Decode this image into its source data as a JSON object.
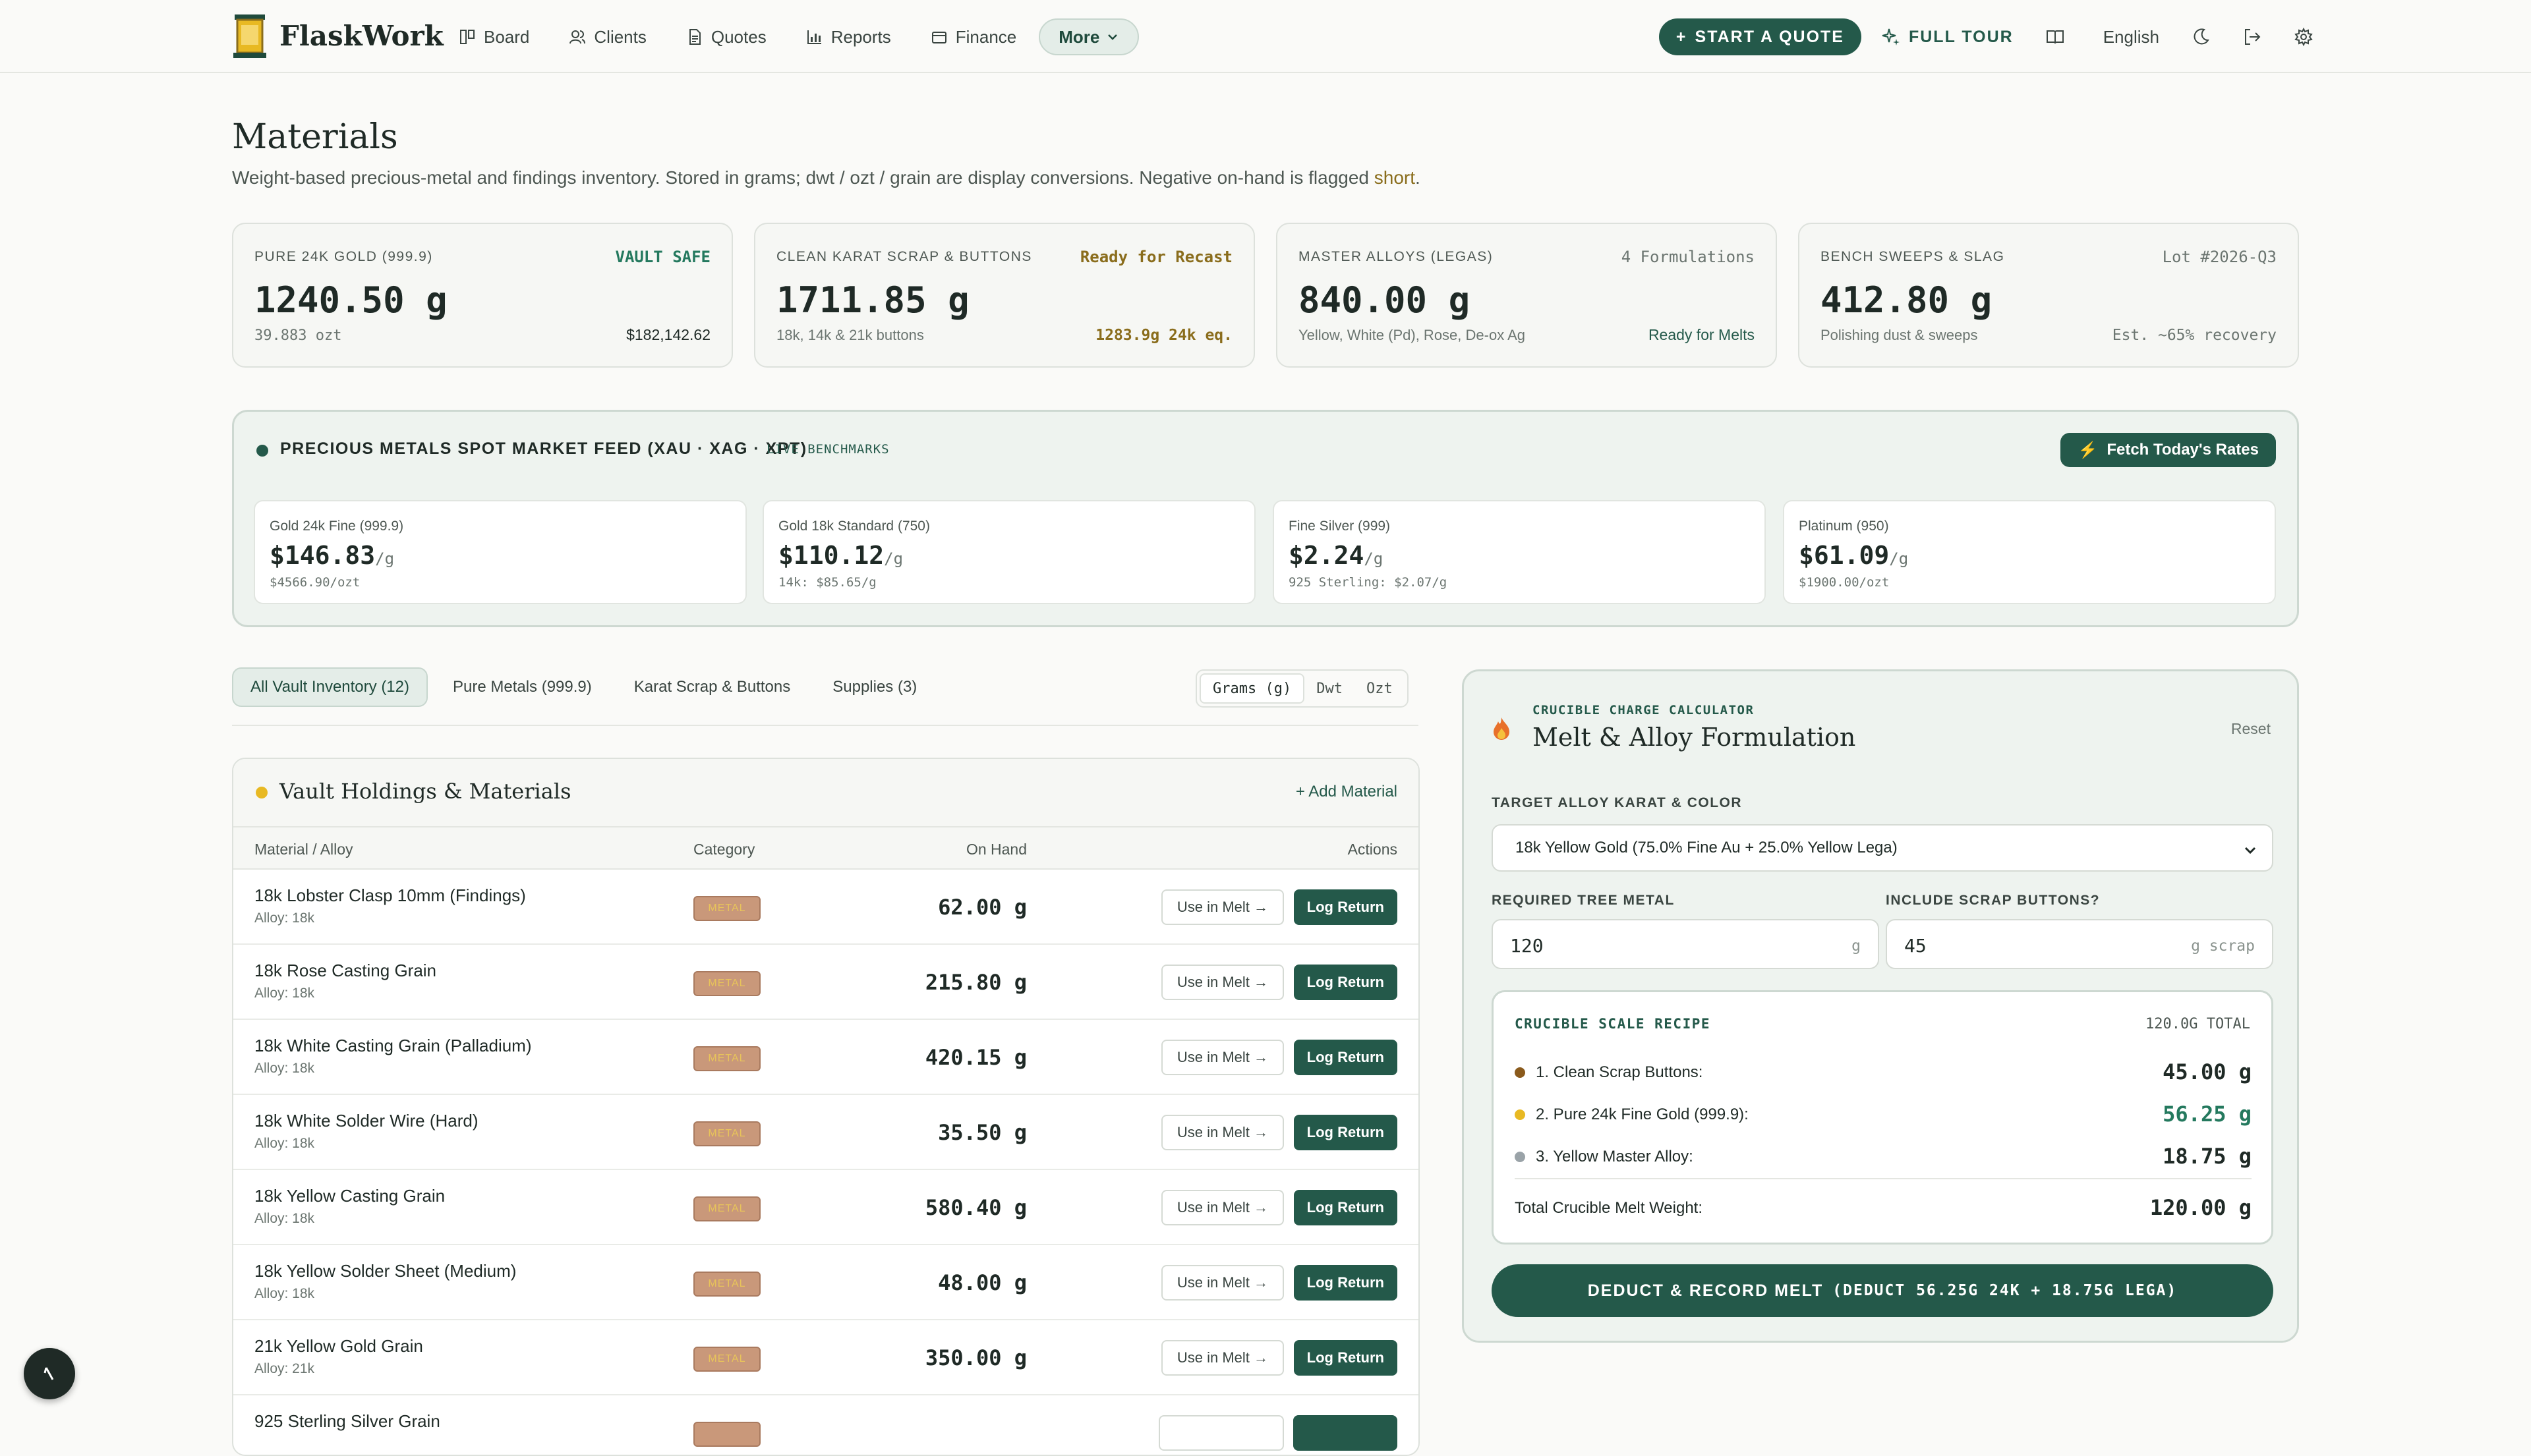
{
  "app": {
    "name": "FlaskWork",
    "nav": [
      {
        "label": "Board",
        "icon": "board-icon"
      },
      {
        "label": "Clients",
        "icon": "users-icon"
      },
      {
        "label": "Quotes",
        "icon": "document-icon"
      },
      {
        "label": "Reports",
        "icon": "chart-icon"
      },
      {
        "label": "Finance",
        "icon": "wallet-icon"
      }
    ],
    "more_label": "More",
    "start_quote": "START A QUOTE",
    "full_tour": "FULL TOUR",
    "language": "English"
  },
  "page": {
    "title": "Materials",
    "subtitle_pre": "Weight-based precious-metal and findings inventory. Stored in grams; dwt / ozt / grain are display conversions. Negative on-hand is flagged ",
    "subtitle_flag": "short",
    "subtitle_post": "."
  },
  "stats": [
    {
      "label": "PURE 24K GOLD (999.9)",
      "tag": "VAULT SAFE",
      "value": "1240.50 g",
      "sub": "39.883 ozt",
      "sub2": "$182,142.62"
    },
    {
      "label": "CLEAN KARAT SCRAP & BUTTONS",
      "tag": "Ready for Recast",
      "value": "1711.85 g",
      "sub": "18k, 14k & 21k buttons",
      "sub2": "1283.9g 24k eq."
    },
    {
      "label": "MASTER ALLOYS (LEGAS)",
      "tag": "4 Formulations",
      "value": "840.00 g",
      "sub": "Yellow, White (Pd), Rose, De-ox Ag",
      "sub2": "Ready for Melts"
    },
    {
      "label": "BENCH SWEEPS & SLAG",
      "tag": "Lot #2026-Q3",
      "value": "412.80 g",
      "sub": "Polishing dust & sweeps",
      "sub2": "Est. ~65% recovery"
    }
  ],
  "spot": {
    "title": "PRECIOUS METALS SPOT MARKET FEED (XAU · XAG · XPT)",
    "live": "LIVE BENCHMARKS",
    "fetch_label": "Fetch Today's Rates",
    "metals": [
      {
        "name": "Gold 24k Fine (999.9)",
        "price": "$146.83",
        "unit": "/g",
        "sub": "$4566.90/ozt"
      },
      {
        "name": "Gold 18k Standard (750)",
        "price": "$110.12",
        "unit": "/g",
        "sub": "14k: $85.65/g"
      },
      {
        "name": "Fine Silver (999)",
        "price": "$2.24",
        "unit": "/g",
        "sub": "925 Sterling: $2.07/g"
      },
      {
        "name": "Platinum (950)",
        "price": "$61.09",
        "unit": "/g",
        "sub": "$1900.00/ozt"
      }
    ]
  },
  "tabs": [
    {
      "label": "All Vault Inventory (12)",
      "active": true
    },
    {
      "label": "Pure Metals (999.9)",
      "active": false
    },
    {
      "label": "Karat Scrap & Buttons",
      "active": false
    },
    {
      "label": "Supplies (3)",
      "active": false
    }
  ],
  "units": [
    {
      "label": "Grams (g)",
      "active": true
    },
    {
      "label": "Dwt",
      "active": false
    },
    {
      "label": "Ozt",
      "active": false
    }
  ],
  "holdings": {
    "title": "Vault Holdings & Materials",
    "add_label": "+ Add Material",
    "columns": {
      "material": "Material / Alloy",
      "category": "Category",
      "on_hand": "On Hand",
      "actions": "Actions"
    },
    "use_label": "Use in Melt →",
    "return_label": "Log Return",
    "rows": [
      {
        "name": "18k Lobster Clasp 10mm (Findings)",
        "alloy": "Alloy: 18k",
        "category": "METAL",
        "on_hand": "62.00 g"
      },
      {
        "name": "18k Rose Casting Grain",
        "alloy": "Alloy: 18k",
        "category": "METAL",
        "on_hand": "215.80 g"
      },
      {
        "name": "18k White Casting Grain (Palladium)",
        "alloy": "Alloy: 18k",
        "category": "METAL",
        "on_hand": "420.15 g"
      },
      {
        "name": "18k White Solder Wire (Hard)",
        "alloy": "Alloy: 18k",
        "category": "METAL",
        "on_hand": "35.50 g"
      },
      {
        "name": "18k Yellow Casting Grain",
        "alloy": "Alloy: 18k",
        "category": "METAL",
        "on_hand": "580.40 g"
      },
      {
        "name": "18k Yellow Solder Sheet (Medium)",
        "alloy": "Alloy: 18k",
        "category": "METAL",
        "on_hand": "48.00 g"
      },
      {
        "name": "21k Yellow Gold Grain",
        "alloy": "Alloy: 21k",
        "category": "METAL",
        "on_hand": "350.00 g"
      },
      {
        "name": "925 Sterling Silver Grain",
        "alloy": "",
        "category": "",
        "on_hand": ""
      }
    ]
  },
  "calculator": {
    "kicker": "CRUCIBLE CHARGE CALCULATOR",
    "title": "Melt & Alloy Formulation",
    "reset": "Reset",
    "target_label": "TARGET ALLOY KARAT & COLOR",
    "target_value": "18k Yellow Gold (75.0% Fine Au + 25.0% Yellow Lega)",
    "tree_label": "REQUIRED TREE METAL",
    "tree_value": "120",
    "tree_unit": "g",
    "scrap_label": "INCLUDE SCRAP BUTTONS?",
    "scrap_value": "45",
    "scrap_unit": "g scrap",
    "recipe_title": "CRUCIBLE SCALE RECIPE",
    "recipe_total_tag": "120.0G TOTAL",
    "recipe": [
      {
        "label": "1. Clean Scrap Buttons:",
        "value": "45.00 g",
        "color": "#8a5a1c",
        "value_color": "#1f2a26"
      },
      {
        "label": "2. Pure 24k Fine Gold (999.9):",
        "value": "56.25 g",
        "color": "#e8b923",
        "value_color": "#24795e"
      },
      {
        "label": "3. Yellow Master Alloy:",
        "value": "18.75 g",
        "color": "#9aa3a8",
        "value_color": "#1f2a26"
      }
    ],
    "total_label": "Total Crucible Melt Weight:",
    "total_value": "120.00 g",
    "deduct_label": "DEDUCT & RECORD MELT",
    "deduct_detail": "(DEDUCT 56.25G 24K + 18.75G LEGA)"
  },
  "colors": {
    "accent": "#24594a",
    "gold": "#e8b923",
    "flag": "#8a6d1c"
  }
}
